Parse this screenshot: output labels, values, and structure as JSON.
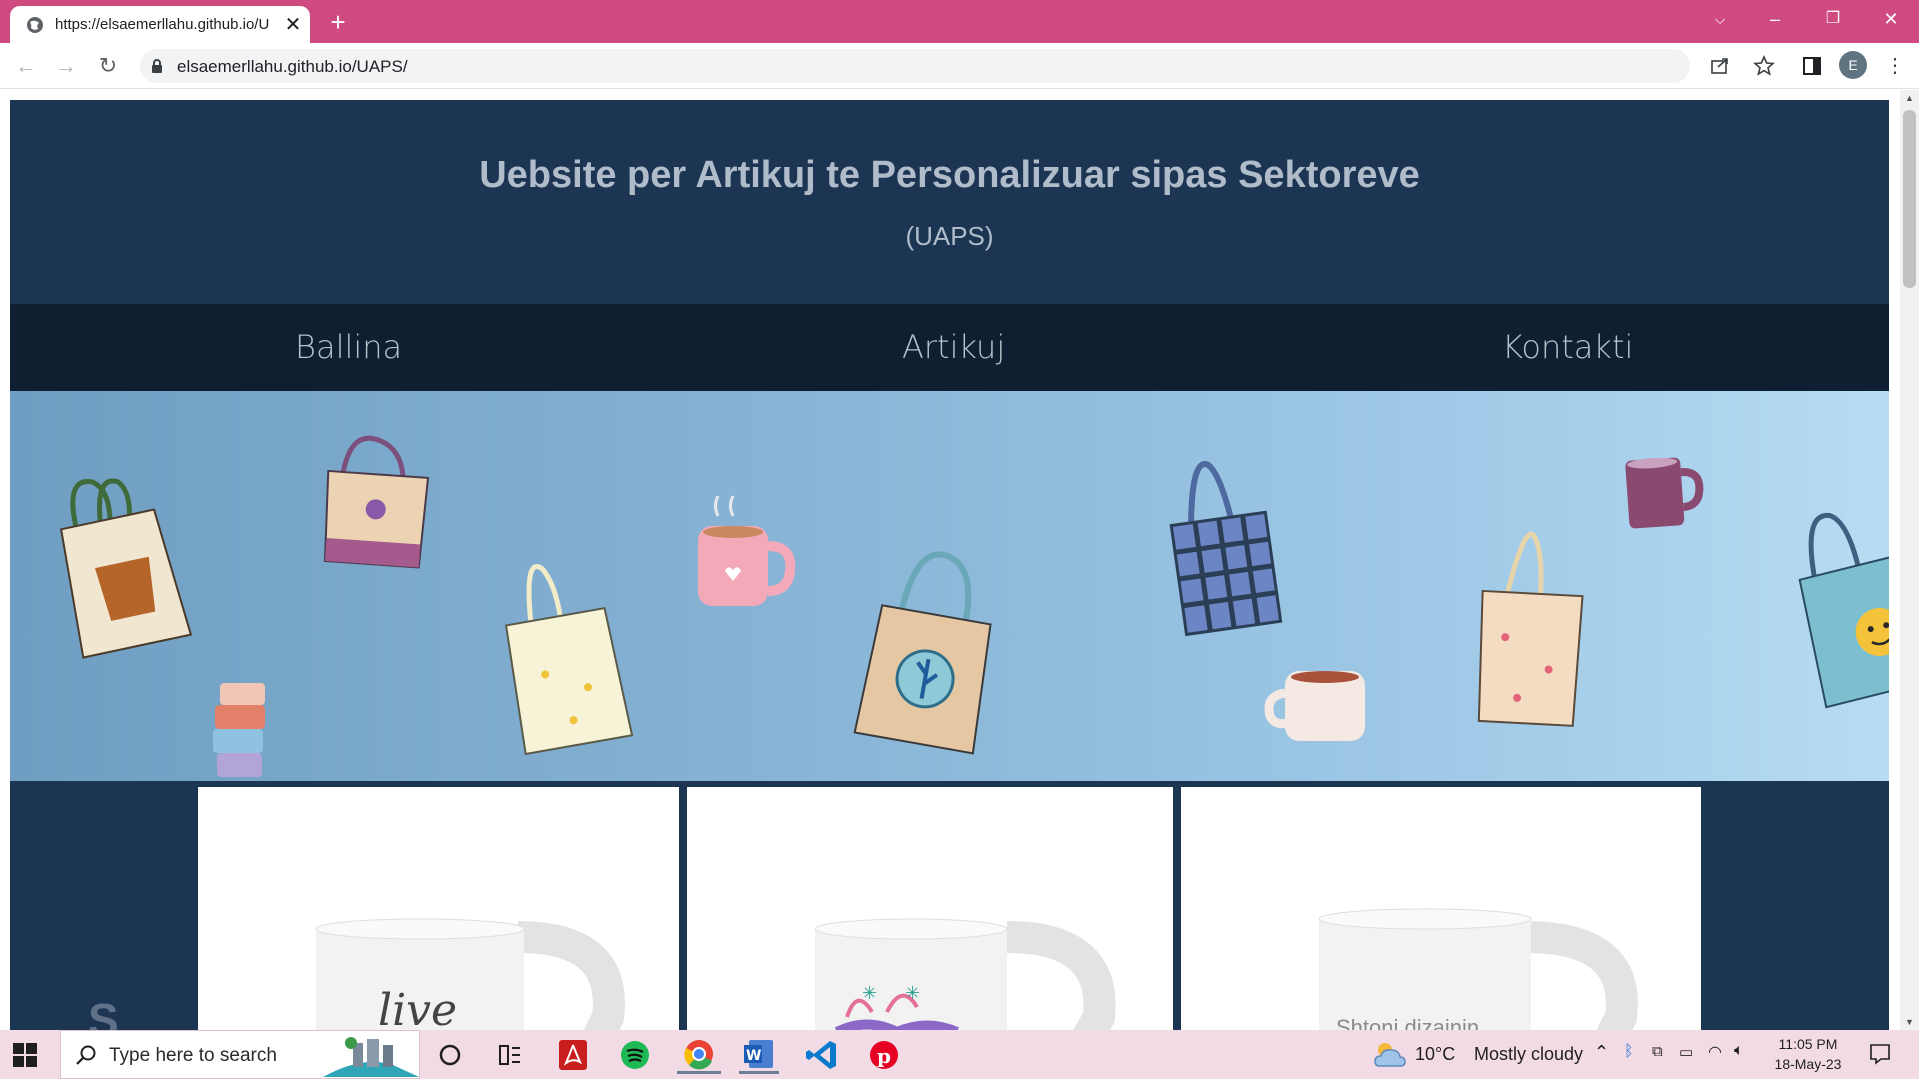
{
  "browser": {
    "tab_title": "https://elsaemerllahu.github.io/U",
    "url": "elsaemerllahu.github.io/UAPS/",
    "profile_initial": "E",
    "accent_color": "#cf4a7f"
  },
  "site": {
    "title": "Uebsite per Artikuj te Personalizuar sipas Sektoreve",
    "subtitle": "(UAPS)",
    "nav": [
      "Ballina",
      "Artikuj",
      "Kontakti"
    ],
    "header_color": "#1b3553",
    "nav_color": "#0f1f31"
  },
  "products": {
    "side_letter": "S",
    "cards": [
      {
        "mug_text": "live"
      },
      {
        "mug_text": ""
      },
      {
        "mug_text": "Shtoni dizajnin"
      }
    ]
  },
  "taskbar": {
    "search_placeholder": "Type here to search",
    "weather_temp": "10°C",
    "weather_desc": "Mostly cloudy",
    "time": "11:05 PM",
    "date": "18-May-23"
  }
}
